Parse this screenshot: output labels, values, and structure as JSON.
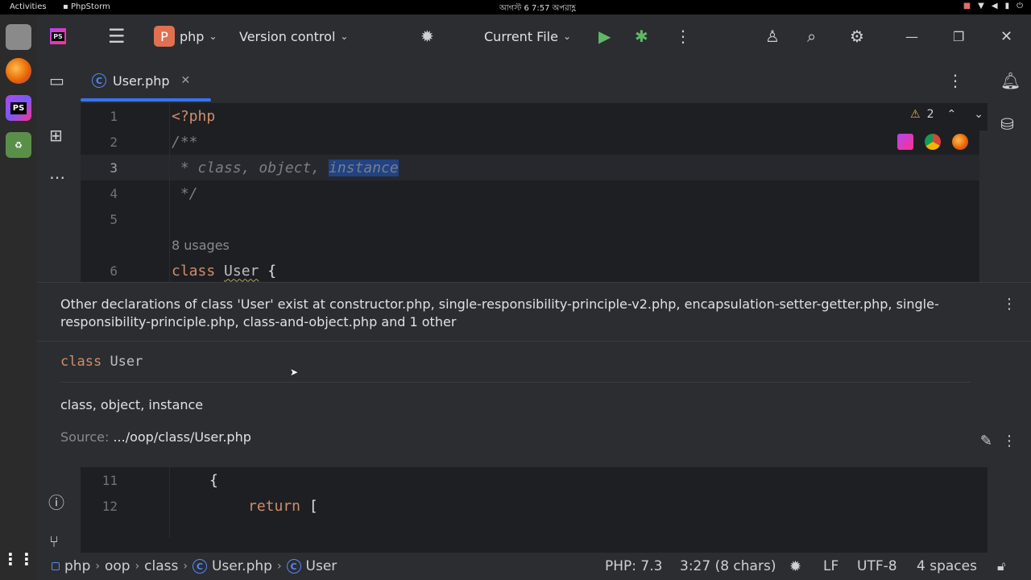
{
  "system_bar": {
    "activities": "Activities",
    "app_name": "PhpStorm",
    "clock": "আগস্ট 6  7:57 অপরাহ্ণ"
  },
  "toolbar": {
    "project_badge": "P",
    "project_name": "php",
    "vcs_label": "Version control",
    "run_config": "Current File"
  },
  "tab": {
    "file_name": "User.php"
  },
  "editor": {
    "lines": [
      {
        "num": "1",
        "text": "<?php"
      },
      {
        "num": "2",
        "text": "/**"
      },
      {
        "num": "3",
        "prefix": " * class, object, ",
        "selected": "instance"
      },
      {
        "num": "4",
        "text": " */"
      },
      {
        "num": "5",
        "text": ""
      },
      {
        "num": "",
        "text": "8 usages"
      },
      {
        "num": "6",
        "keyword": "class",
        "name": "User",
        "suffix": " {"
      }
    ],
    "warnings_count": "2"
  },
  "popup": {
    "warning": "Other declarations of class 'User' exist at constructor.php, single-responsibility-principle-v2.php, encapsulation-setter-getter.php, single-responsibility-principle.php, class-and-object.php and 1 other",
    "signature_keyword": "class",
    "signature_name": "User",
    "doc_text": "class, object, instance",
    "source_label": "Source:",
    "source_path": ".../oop/class/User.php"
  },
  "editor_bottom": {
    "lines": [
      {
        "num": "11",
        "text": "{"
      },
      {
        "num": "12",
        "keyword": "return",
        "suffix": " ["
      }
    ]
  },
  "status": {
    "crumbs": [
      "php",
      "oop",
      "class",
      "User.php",
      "User"
    ],
    "php_version": "PHP: 7.3",
    "caret": "3:27 (8 chars)",
    "line_sep": "LF",
    "encoding": "UTF-8",
    "indent": "4 spaces"
  },
  "colors": {
    "accent": "#3574f0",
    "project_badge": "#e0704f",
    "run_green": "#5fb865"
  }
}
